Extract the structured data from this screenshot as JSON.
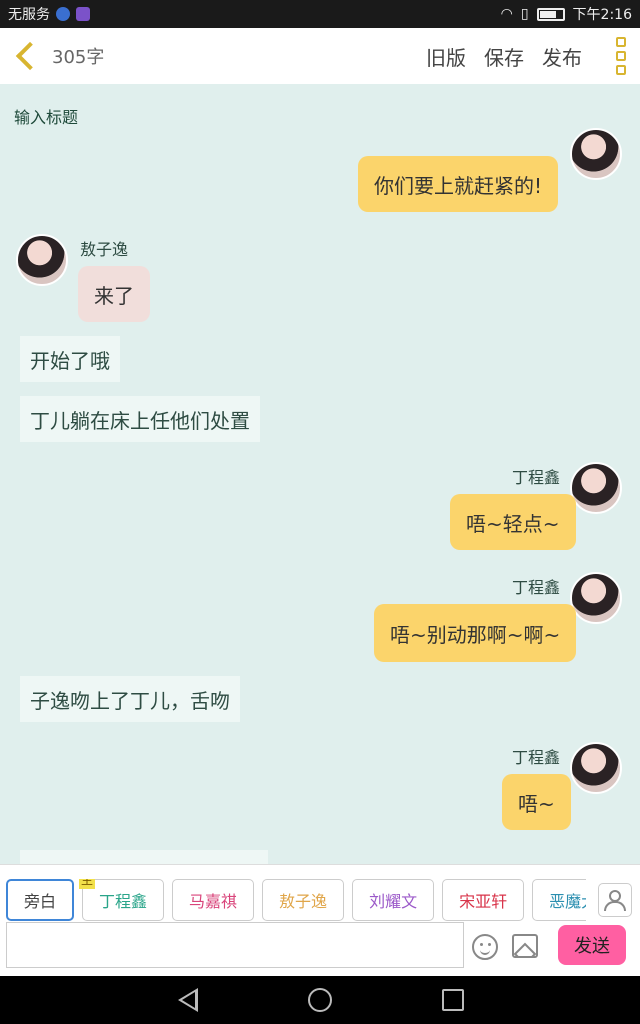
{
  "status_bar": {
    "carrier": "无服务",
    "time": "下午2:16"
  },
  "header": {
    "word_count": "305字",
    "actions": {
      "old_version": "旧版",
      "save": "保存",
      "publish": "发布"
    }
  },
  "title_placeholder": "输入标题",
  "messages": [
    {
      "type": "right",
      "speaker": "",
      "text": "你们要上就赶紧的!"
    },
    {
      "type": "left",
      "speaker": "敖子逸",
      "text": "来了"
    },
    {
      "type": "narration",
      "text": "开始了哦"
    },
    {
      "type": "narration",
      "text": "丁儿躺在床上任他们处置"
    },
    {
      "type": "right",
      "speaker": "丁程鑫",
      "text": "唔~轻点~"
    },
    {
      "type": "right",
      "speaker": "丁程鑫",
      "text": "唔~别动那啊~啊~"
    },
    {
      "type": "narration",
      "text": "子逸吻上了丁儿，舌吻"
    },
    {
      "type": "right",
      "speaker": "丁程鑫",
      "text": "唔~"
    }
  ],
  "roles": {
    "narrator": "旁白",
    "main_tag": "主",
    "list": [
      {
        "label": "丁程鑫",
        "color": "#2aa58a"
      },
      {
        "label": "马嘉祺",
        "color": "#d9457b"
      },
      {
        "label": "敖子逸",
        "color": "#e0a64a"
      },
      {
        "label": "刘耀文",
        "color": "#9b59c9"
      },
      {
        "label": "宋亚轩",
        "color": "#d8344a"
      },
      {
        "label": "恶魔大大",
        "color": "#2b8fb0"
      }
    ]
  },
  "composer": {
    "message_value": "",
    "send_label": "发送"
  },
  "colors": {
    "accent_yellow": "#d8b530",
    "bubble_right": "#fbd46b",
    "send_pink": "#ff5fa2",
    "background": "#e0efed"
  }
}
